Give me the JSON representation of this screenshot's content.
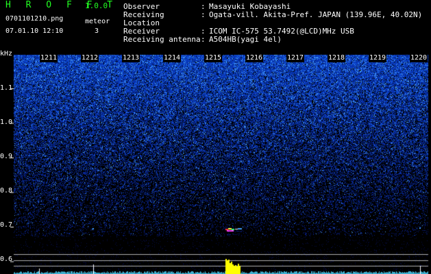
{
  "app": {
    "name": "H R O F F T",
    "version": "1.0.0"
  },
  "file": {
    "name": "0701101210.png",
    "datetime": "07.01.10 12:10"
  },
  "meteor": {
    "label": "meteor",
    "count": "3"
  },
  "meta": [
    {
      "key": "Observer",
      "colon": ":",
      "value": "Masayuki Kobayashi"
    },
    {
      "key": "Receiving Location",
      "colon": ":",
      "value": "Ogata-vill. Akita-Pref. JAPAN (139.96E, 40.02N)"
    },
    {
      "key": "Receiver",
      "colon": ":",
      "value": "ICOM IC-575 53.7492(@LCD)MHz USB"
    },
    {
      "key": "Receiving antenna",
      "colon": ":",
      "value": "A504HB(yagi 4el)"
    }
  ],
  "y_axis": {
    "unit": "kHz",
    "ticks": [
      "1.1",
      "1.0",
      "0.9",
      "0.8",
      "0.7",
      "0.6"
    ]
  },
  "x_axis": {
    "ticks": [
      "1211",
      "1212",
      "1213",
      "1214",
      "1215",
      "1216",
      "1217",
      "1218",
      "1219",
      "1220"
    ]
  },
  "colors": {
    "background": "#000000",
    "title_green": "#22ff22",
    "noise_dark": "#0a1a80",
    "noise_bright": "#5fa8ff",
    "meteor_yellow": "#ffff00",
    "guide_line": "#b0b0b0"
  }
}
